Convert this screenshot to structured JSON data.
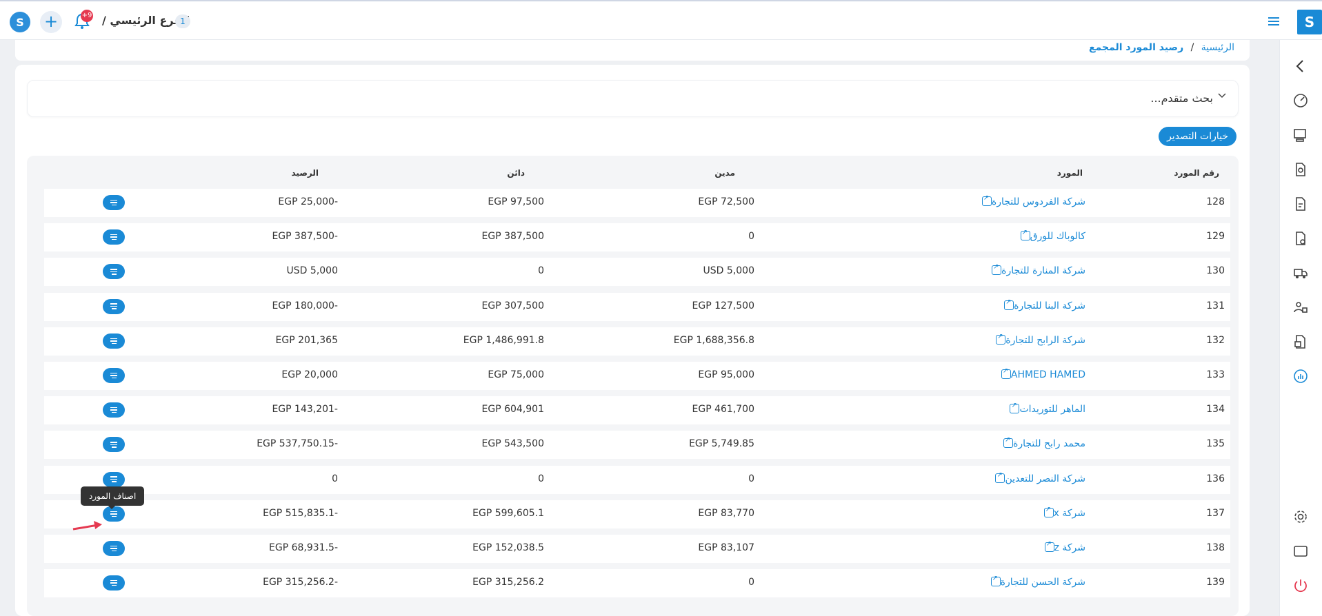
{
  "topbar": {
    "branch_label": "الفرع الرئيسي /",
    "branch_count": "1",
    "notification_badge": "+9",
    "logo_glyph": "S"
  },
  "breadcrumb": {
    "home": "الرئيسية",
    "separator": "/",
    "current": "رصيد المورد المجمع"
  },
  "advanced_search_label": "بحث متقدم...",
  "export_label": "خيارات التصدير",
  "table": {
    "headers": {
      "number": "رقم المورد",
      "supplier": "المورد",
      "debit": "مدين",
      "credit": "دائن",
      "balance": "الرصيد"
    },
    "rows": [
      {
        "number": "128",
        "supplier": "شركة الفردوس للتجارة",
        "debit": "EGP 72,500",
        "credit": "EGP 97,500",
        "balance": "EGP 25,000-"
      },
      {
        "number": "129",
        "supplier": "كالوباك للورق",
        "debit": "0",
        "credit": "EGP 387,500",
        "balance": "EGP 387,500-"
      },
      {
        "number": "130",
        "supplier": "شركة المنارة للتجارة",
        "debit": "USD 5,000",
        "credit": "0",
        "balance": "USD 5,000"
      },
      {
        "number": "131",
        "supplier": "شركة البنا للتجارة",
        "debit": "EGP 127,500",
        "credit": "EGP 307,500",
        "balance": "EGP 180,000-"
      },
      {
        "number": "132",
        "supplier": "شركة الرابح للتجارة",
        "debit": "EGP 1,688,356.8",
        "credit": "EGP 1,486,991.8",
        "balance": "EGP 201,365"
      },
      {
        "number": "133",
        "supplier": "AHMED HAMED",
        "debit": "EGP 95,000",
        "credit": "EGP 75,000",
        "balance": "EGP 20,000"
      },
      {
        "number": "134",
        "supplier": "الماهر للتوريدات",
        "debit": "EGP 461,700",
        "credit": "EGP 604,901",
        "balance": "EGP 143,201-"
      },
      {
        "number": "135",
        "supplier": "محمد رابح للتجارة",
        "debit": "EGP 5,749.85",
        "credit": "EGP 543,500",
        "balance": "EGP 537,750.15-"
      },
      {
        "number": "136",
        "supplier": "شركة النصر للتعدين",
        "debit": "0",
        "credit": "0",
        "balance": "0"
      },
      {
        "number": "137",
        "supplier": "شركة x",
        "debit": "EGP 83,770",
        "credit": "EGP 599,605.1",
        "balance": "EGP 515,835.1-"
      },
      {
        "number": "138",
        "supplier": "شركة z",
        "debit": "EGP 83,107",
        "credit": "EGP 152,038.5",
        "balance": "EGP 68,931.5-"
      },
      {
        "number": "139",
        "supplier": "شركة الحسن للتجارة",
        "debit": "0",
        "credit": "EGP 315,256.2",
        "balance": "EGP 315,256.2-"
      }
    ]
  },
  "tooltip_label": "اصناف المورد",
  "colors": {
    "accent": "#1a8ad6",
    "danger": "#e53950"
  },
  "sidebar_icons": [
    "chevron-left-icon",
    "dashboard-icon",
    "pos-icon",
    "search-doc-icon",
    "invoice-icon",
    "purchase-icon",
    "delivery-icon",
    "users-icon",
    "warehouse-icon",
    "reports-icon",
    "settings-icon",
    "window-icon",
    "power-icon"
  ]
}
